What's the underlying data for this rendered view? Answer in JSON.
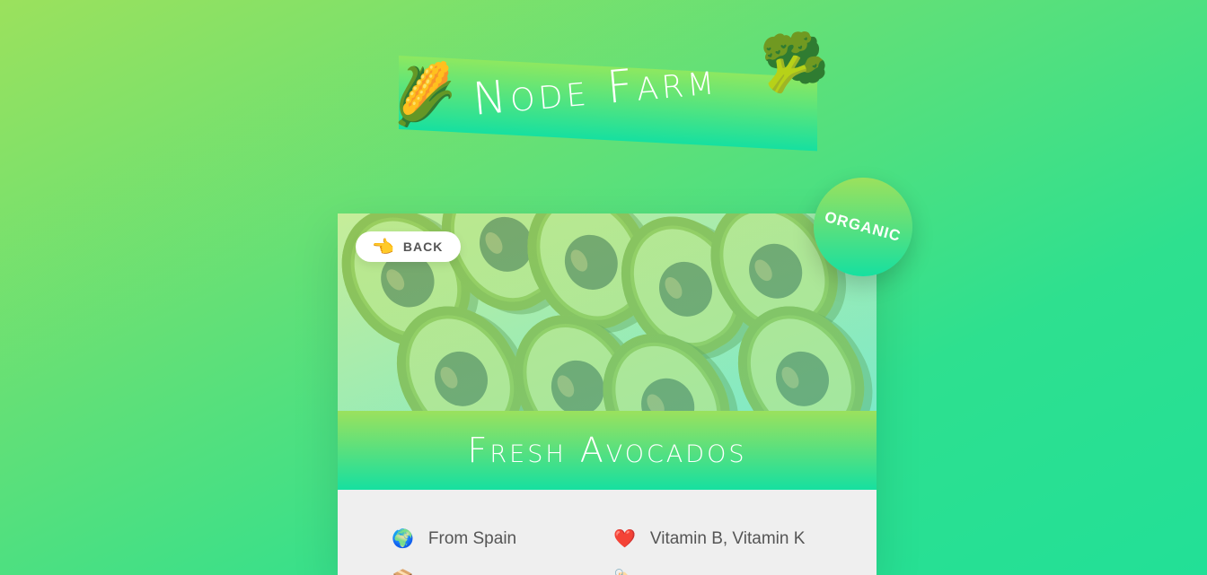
{
  "header": {
    "title": "Node Farm",
    "emoji_left": "🌽",
    "emoji_right": "🥦"
  },
  "product": {
    "back_label": "BACK",
    "back_icon": "👈",
    "badge_label": "ORGANIC",
    "name": "Fresh Avocados",
    "origin_icon": "🌍",
    "origin": "From Spain",
    "nutrients_icon": "❤️",
    "nutrients": "Vitamin B, Vitamin K",
    "quantity_icon": "📦",
    "price_icon": "🏷️"
  },
  "colors": {
    "accent_start": "#9be15d",
    "accent_end": "#16e0a0",
    "card_bg": "#efefef"
  }
}
